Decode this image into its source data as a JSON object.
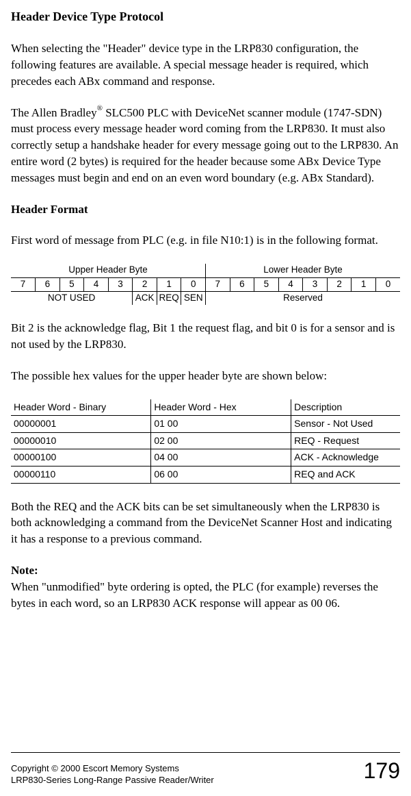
{
  "title": "Header Device Type Protocol",
  "para1": "When selecting the \"Header\" device type in the LRP830 configuration, the following features are available.  A special message header is required, which precedes each ABx command and response.",
  "para2a": "The Allen Bradley",
  "para2b": "  SLC500 PLC with DeviceNet scanner module (1747-SDN) must process every message header word coming from the LRP830.  It must also correctly setup a handshake header for every message going out to the LRP830.  An entire word (2 bytes) is required for the header because some ABx Device Type messages must begin and end on an even word boundary (e.g. ABx Standard).",
  "subtitle1": "Header Format",
  "para3": "First word of message from PLC (e.g. in file N10:1) is in the following format.",
  "bit_table": {
    "header_left": "Upper Header Byte",
    "header_right": "Lower Header Byte",
    "bits_upper": [
      "7",
      "6",
      "5",
      "4",
      "3",
      "2",
      "1",
      "0"
    ],
    "bits_lower": [
      "7",
      "6",
      "5",
      "4",
      "3",
      "2",
      "1",
      "0"
    ],
    "label_not_used": "NOT USED",
    "label_ack": "ACK",
    "label_req": "REQ",
    "label_sen": "SEN",
    "label_reserved": "Reserved"
  },
  "para4": "Bit 2 is the acknowledge flag, Bit 1 the request flag, and bit 0 is for a sensor and is not used by the LRP830.",
  "para5": "The possible hex values for the upper header byte are shown below:",
  "hex_table": {
    "headers": [
      "Header Word - Binary",
      "Header Word - Hex",
      "Description"
    ],
    "rows": [
      [
        "00000001",
        "01 00",
        "Sensor  - Not Used"
      ],
      [
        "00000010",
        "02 00",
        "REQ - Request"
      ],
      [
        "00000100",
        "04 00",
        "ACK - Acknowledge"
      ],
      [
        "00000110",
        "06 00",
        "REQ and ACK"
      ]
    ]
  },
  "para6": "Both the REQ and the ACK bits can be set simultaneously when the LRP830 is both acknowledging a command from the DeviceNet Scanner Host and indicating it has a response to a previous command.",
  "note_label": "Note:",
  "note_body": "When \"unmodified\" byte ordering is opted, the PLC (for example) reverses the bytes in each word, so an LRP830 ACK response will appear as 00 06.",
  "footer": {
    "line1": "Copyright © 2000 Escort Memory Systems",
    "line2": "LRP830-Series Long-Range Passive Reader/Writer",
    "page": "179"
  },
  "chart_data": [
    {
      "type": "table",
      "title": "Header Format bit layout",
      "columns_upper": [
        "7",
        "6",
        "5",
        "4",
        "3",
        "2",
        "1",
        "0"
      ],
      "columns_lower": [
        "7",
        "6",
        "5",
        "4",
        "3",
        "2",
        "1",
        "0"
      ],
      "upper_labels": {
        "7-3": "NOT USED",
        "2": "ACK",
        "1": "REQ",
        "0": "SEN"
      },
      "lower_labels": {
        "7-0": "Reserved"
      }
    },
    {
      "type": "table",
      "title": "Upper header byte hex values",
      "columns": [
        "Header Word - Binary",
        "Header Word - Hex",
        "Description"
      ],
      "rows": [
        [
          "00000001",
          "01 00",
          "Sensor  - Not Used"
        ],
        [
          "00000010",
          "02 00",
          "REQ - Request"
        ],
        [
          "00000100",
          "04 00",
          "ACK - Acknowledge"
        ],
        [
          "00000110",
          "06 00",
          "REQ and ACK"
        ]
      ]
    }
  ]
}
